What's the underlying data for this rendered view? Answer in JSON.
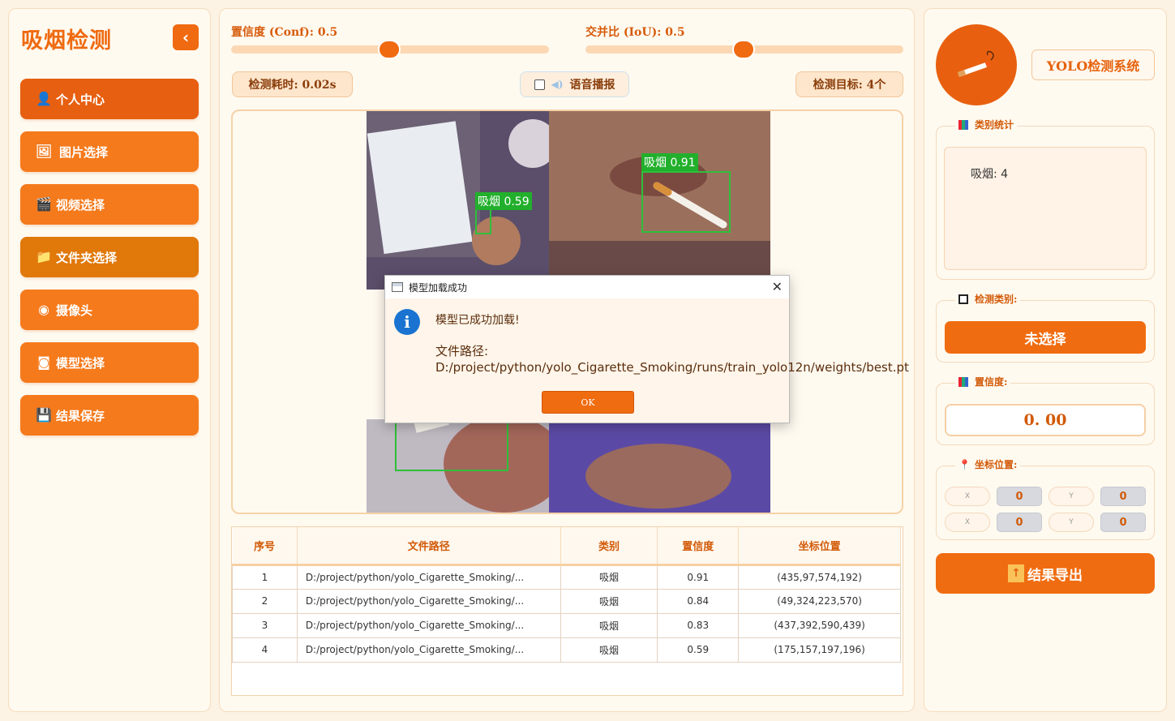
{
  "sidebar": {
    "title": "吸烟检测",
    "collapse_icon": "‹",
    "items": [
      {
        "label": "个人中心",
        "icon": "user-icon",
        "glyph": "👤"
      },
      {
        "label": "图片选择",
        "icon": "image-icon",
        "glyph": "🖼"
      },
      {
        "label": "视频选择",
        "icon": "clapper-icon",
        "glyph": "🎬"
      },
      {
        "label": "文件夹选择",
        "icon": "folder-icon",
        "glyph": "📁"
      },
      {
        "label": "摄像头",
        "icon": "camera-icon",
        "glyph": "◉"
      },
      {
        "label": "模型选择",
        "icon": "model-icon",
        "glyph": "◙"
      },
      {
        "label": "结果保存",
        "icon": "save-icon",
        "glyph": "💾"
      }
    ]
  },
  "controls": {
    "conf_label": "置信度 (Conf): 0.5",
    "conf_value": 0.5,
    "iou_label": "交并比 (IoU): 0.5",
    "iou_value": 0.5,
    "time_label": "检测耗时: 0.02s",
    "voice_label": "语音播报",
    "target_label": "检测目标: 4个"
  },
  "detections_overlay": [
    {
      "label": "吸烟 0.91"
    },
    {
      "label": "吸烟 0.59"
    }
  ],
  "dialog": {
    "title": "模型加载成功",
    "message": "模型已成功加载!",
    "path_text": "文件路径: D:/project/python/yolo_Cigarette_Smoking/runs/train_yolo12n/weights/best.pt",
    "ok_label": "OK"
  },
  "table": {
    "headers": [
      "序号",
      "文件路径",
      "类别",
      "置信度",
      "坐标位置"
    ],
    "rows": [
      [
        "1",
        "D:/project/python/yolo_Cigarette_Smoking/...",
        "吸烟",
        "0.91",
        "(435,97,574,192)"
      ],
      [
        "2",
        "D:/project/python/yolo_Cigarette_Smoking/...",
        "吸烟",
        "0.84",
        "(49,324,223,570)"
      ],
      [
        "3",
        "D:/project/python/yolo_Cigarette_Smoking/...",
        "吸烟",
        "0.83",
        "(437,392,590,439)"
      ],
      [
        "4",
        "D:/project/python/yolo_Cigarette_Smoking/...",
        "吸烟",
        "0.59",
        "(175,157,197,196)"
      ]
    ]
  },
  "right": {
    "system_title": "YOLO检测系统",
    "stats_group": "类别统计",
    "stats_text": "吸烟: 4",
    "class_group": "检测类别:",
    "class_button": "未选择",
    "conf_group": "置信度:",
    "conf_value": "0. 00",
    "coord_group": "坐标位置:",
    "coords": [
      {
        "label": "X",
        "value": "0"
      },
      {
        "label": "Y",
        "value": "0"
      },
      {
        "label": "X",
        "value": "0"
      },
      {
        "label": "Y",
        "value": "0"
      }
    ],
    "export_label": "结果导出"
  },
  "colors": {
    "accent": "#ef6a10",
    "background": "#fdf3e4",
    "box": "#2fbf3a"
  }
}
